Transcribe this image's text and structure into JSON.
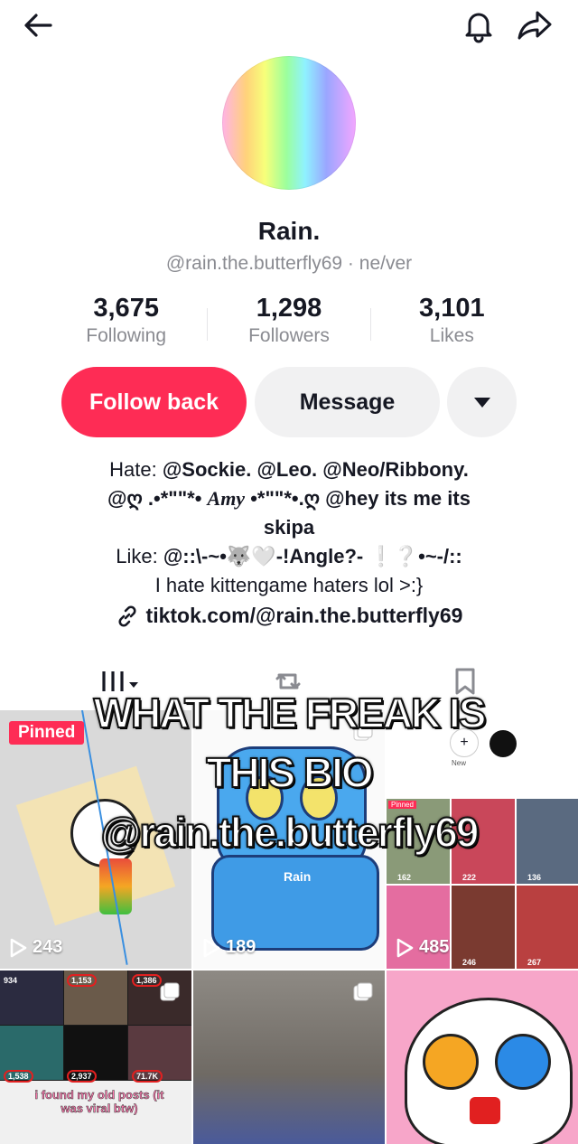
{
  "profile": {
    "name": "Rain.",
    "handle_line": "@rain.the.butterfly69 · ne/ver",
    "stats": [
      {
        "value": "3,675",
        "label": "Following"
      },
      {
        "value": "1,298",
        "label": "Followers"
      },
      {
        "value": "3,101",
        "label": "Likes"
      }
    ],
    "follow_label": "Follow back",
    "message_label": "Message",
    "bio": {
      "line1_prefix": "Hate: ",
      "line1_bold": "@Sockie. @Leo. @Neo/Ribbony.",
      "line2_a": "@ღ .•*\"\"*• ",
      "line2_italic": "Amy",
      "line2_b": " •*\"\"*•.ღ @hey its me its",
      "line3": "skipa",
      "line4_prefix": "Like: ",
      "line4_bold": "@::\\-~•🐺🤍-!Angle?- ❕❔•~-/::",
      "line5": "I hate kittengame haters lol >:}"
    },
    "link": "tiktok.com/@rain.the.butterfly69"
  },
  "overlay_text": {
    "line1": "WHAT THE FREAK IS",
    "line2": "THIS BIO",
    "line3": "@rain.the.butterfly69"
  },
  "videos": [
    {
      "views": "243",
      "pinned_label": "Pinned"
    },
    {
      "views": "189",
      "sticker_text": "Rain"
    },
    {
      "views": "485",
      "mini_new": "New",
      "mini_pinned": "Pinned",
      "mini_counts": [
        "162",
        "222",
        "136",
        "246",
        "267"
      ]
    },
    {
      "mini_counts": [
        "934",
        "1,153",
        "1,386",
        "1,538",
        "2,937",
        "71.7K"
      ],
      "caption": "i found my old posts (it was viral btw)"
    },
    {},
    {}
  ],
  "colors": {
    "accent": "#fe2c55",
    "muted": "#8a8b91",
    "button_gray": "#f1f1f2"
  }
}
